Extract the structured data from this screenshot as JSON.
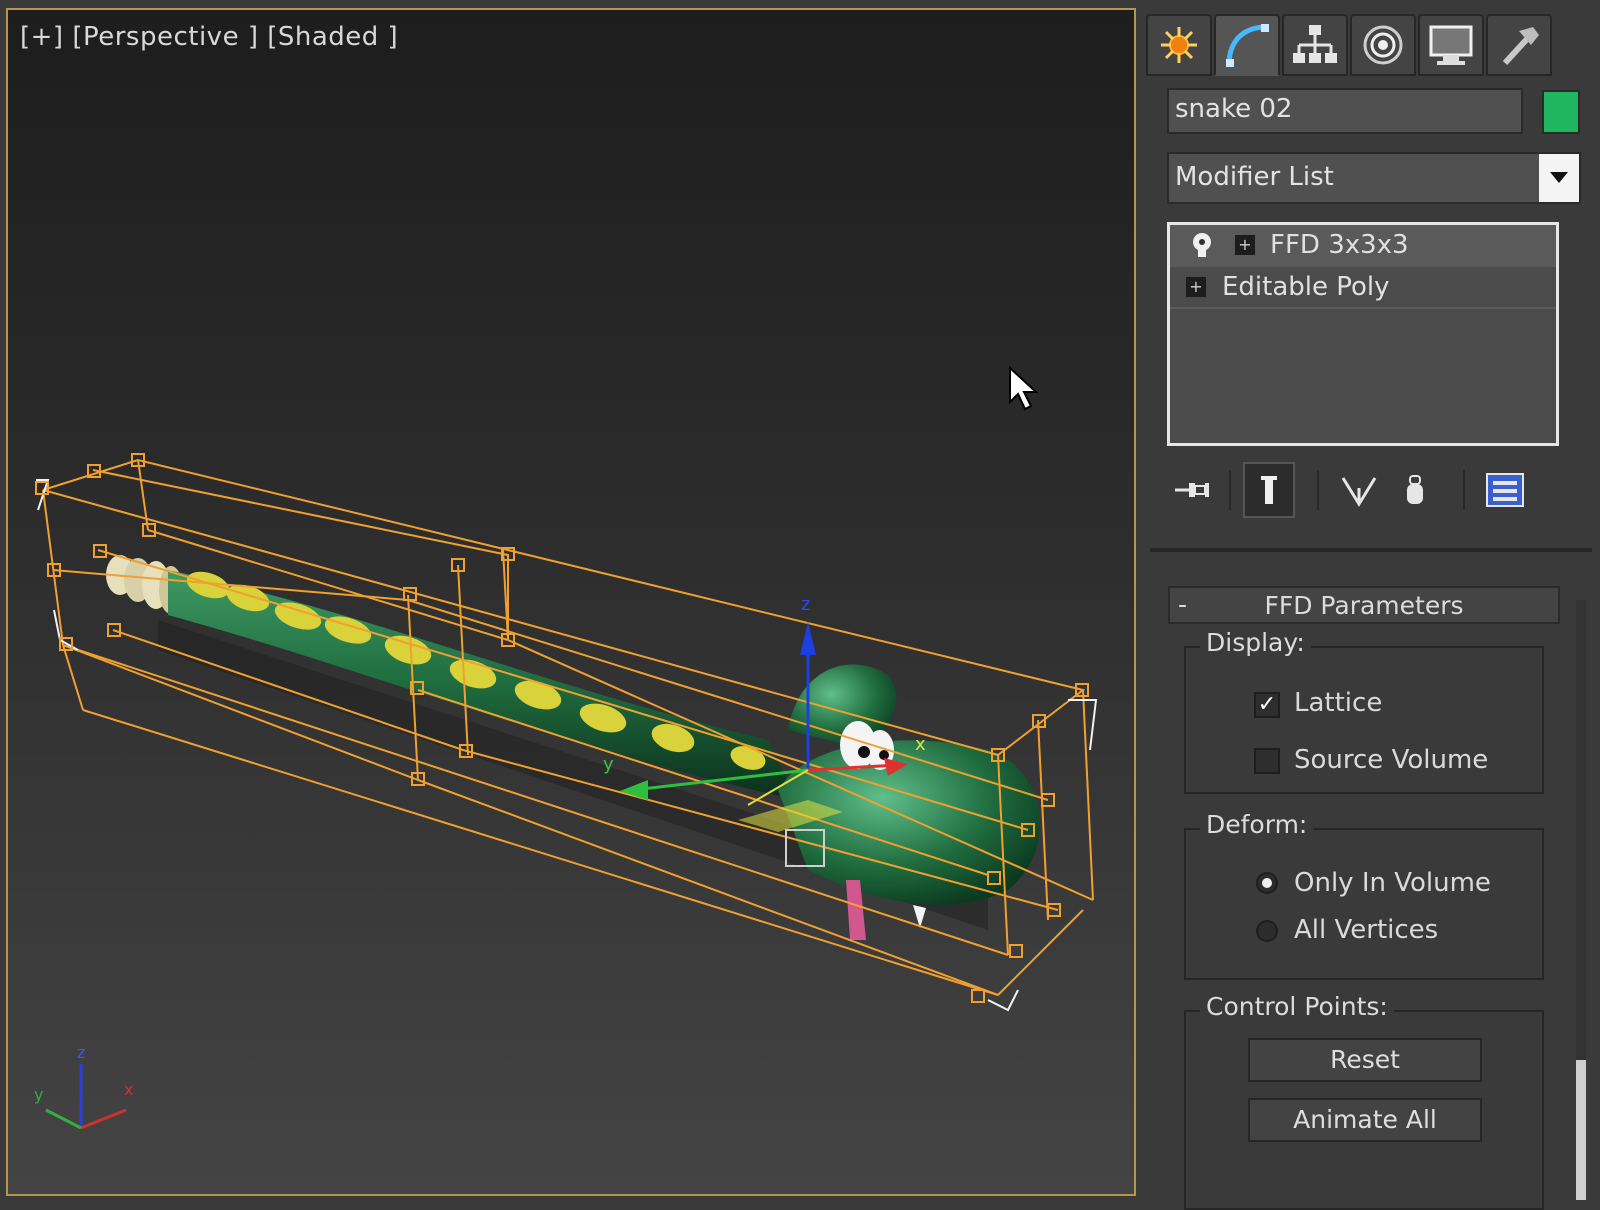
{
  "viewport": {
    "label": "[+] [Perspective ] [Shaded ]",
    "gizmo_axes": {
      "z": "z",
      "y": "y",
      "x": "x"
    },
    "tripod_axes": {
      "z": "z",
      "y": "y",
      "x": "x"
    }
  },
  "command_panel": {
    "tabs": [
      {
        "icon": "create-icon"
      },
      {
        "icon": "modify-icon"
      },
      {
        "icon": "hierarchy-icon"
      },
      {
        "icon": "motion-icon"
      },
      {
        "icon": "display-icon"
      },
      {
        "icon": "utilities-icon"
      }
    ],
    "object_name": "snake 02",
    "object_color": "#1fb660",
    "modifier_list": "Modifier List",
    "stack": [
      {
        "label": "FFD 3x3x3",
        "selected": true
      },
      {
        "label": "Editable Poly",
        "selected": false
      }
    ]
  },
  "ffd_parameters": {
    "title": "FFD Parameters",
    "collapse": "-",
    "display": {
      "label": "Display:",
      "lattice": {
        "label": "Lattice",
        "checked": true
      },
      "source_volume": {
        "label": "Source Volume",
        "checked": false
      }
    },
    "deform": {
      "label": "Deform:",
      "only_in_volume": {
        "label": "Only In Volume",
        "selected": true
      },
      "all_vertices": {
        "label": "All Vertices",
        "selected": false
      }
    },
    "control_points": {
      "label": "Control Points:",
      "reset": "Reset",
      "animate_all": "Animate All"
    }
  },
  "colors": {
    "lattice": "#f0a030",
    "snake_body": "#1f6b3e",
    "snake_spots": "#d9d23a",
    "viewport_border": "#b5964a"
  }
}
